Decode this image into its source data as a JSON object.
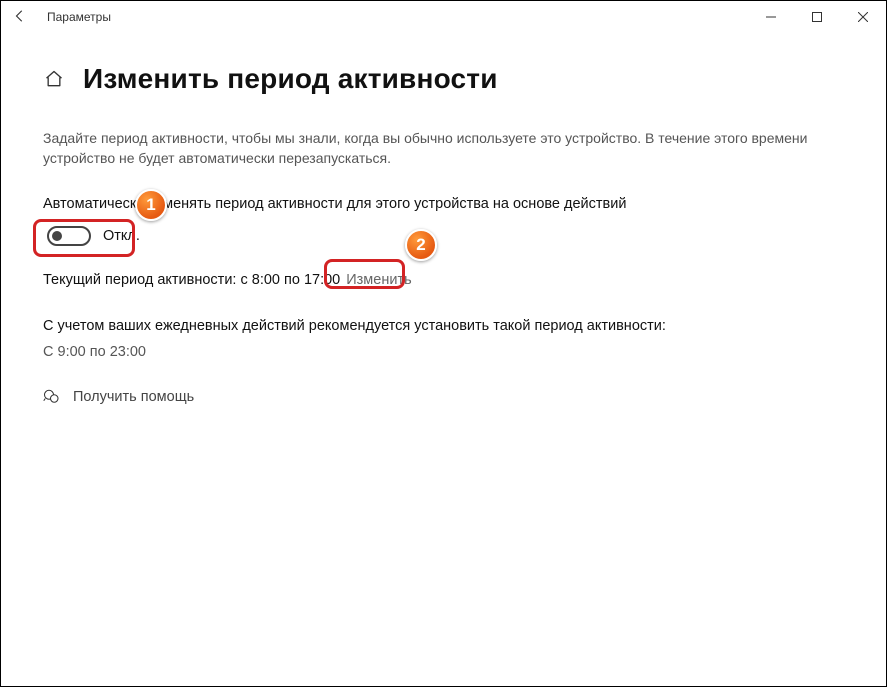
{
  "titlebar": {
    "title": "Параметры"
  },
  "page": {
    "title": "Изменить период активности",
    "description": "Задайте период активности, чтобы мы знали, когда вы обычно используете это устройство. В течение этого времени устройство не будет автоматически перезапускаться."
  },
  "auto_adjust": {
    "label": "Автоматически изменять период активности для этого устройства на основе действий",
    "toggle_state": "Откл."
  },
  "current": {
    "prefix": "Текущий период активности: с 8:00 по 17:00",
    "change": "Изменить"
  },
  "recommend": {
    "label": "С учетом ваших ежедневных действий рекомендуется установить такой период активности:",
    "value": "С 9:00 по 23:00"
  },
  "help": {
    "label": "Получить помощь"
  },
  "annotations": {
    "one": "1",
    "two": "2"
  }
}
